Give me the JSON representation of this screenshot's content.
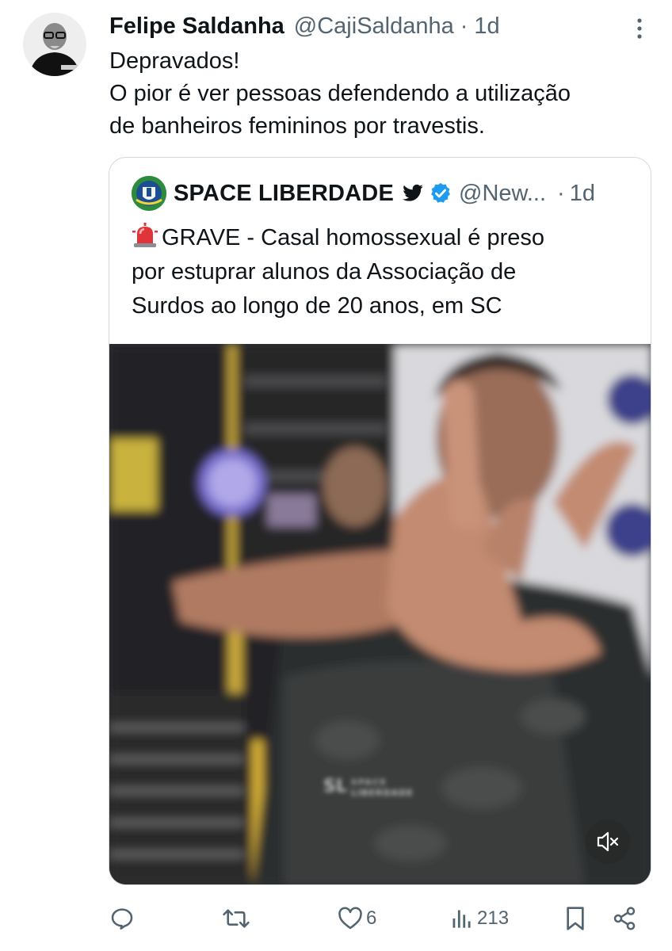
{
  "tweet": {
    "author_name": "Felipe Saldanha",
    "author_handle": "@CajiSaldanha",
    "separator": "·",
    "time": "1d",
    "text_lines": [
      "Depravados!",
      "O pior é ver pessoas defendendo a utilização",
      "de banheiros femininos por travestis."
    ]
  },
  "quote": {
    "author_name": "SPACE LIBERDADE",
    "author_handle": "@New...",
    "separator": "·",
    "time": "1d",
    "text_lines": [
      "GRAVE - Casal homossexual é preso",
      "por estuprar alunos da Associação de",
      "Surdos ao longo de 20 anos, em SC"
    ],
    "video": {
      "shirt_text": "SL SPACE LIBERDADE"
    }
  },
  "actions": {
    "reply_icon": "reply-icon",
    "retweet_icon": "retweet-icon",
    "like_count": "6",
    "views_count": "213",
    "bookmark_icon": "bookmark-icon",
    "share_icon": "share-icon"
  },
  "colors": {
    "text": "#0f1419",
    "secondary": "#536471",
    "border": "#cfd9de",
    "verified": "#1d9bf0"
  }
}
